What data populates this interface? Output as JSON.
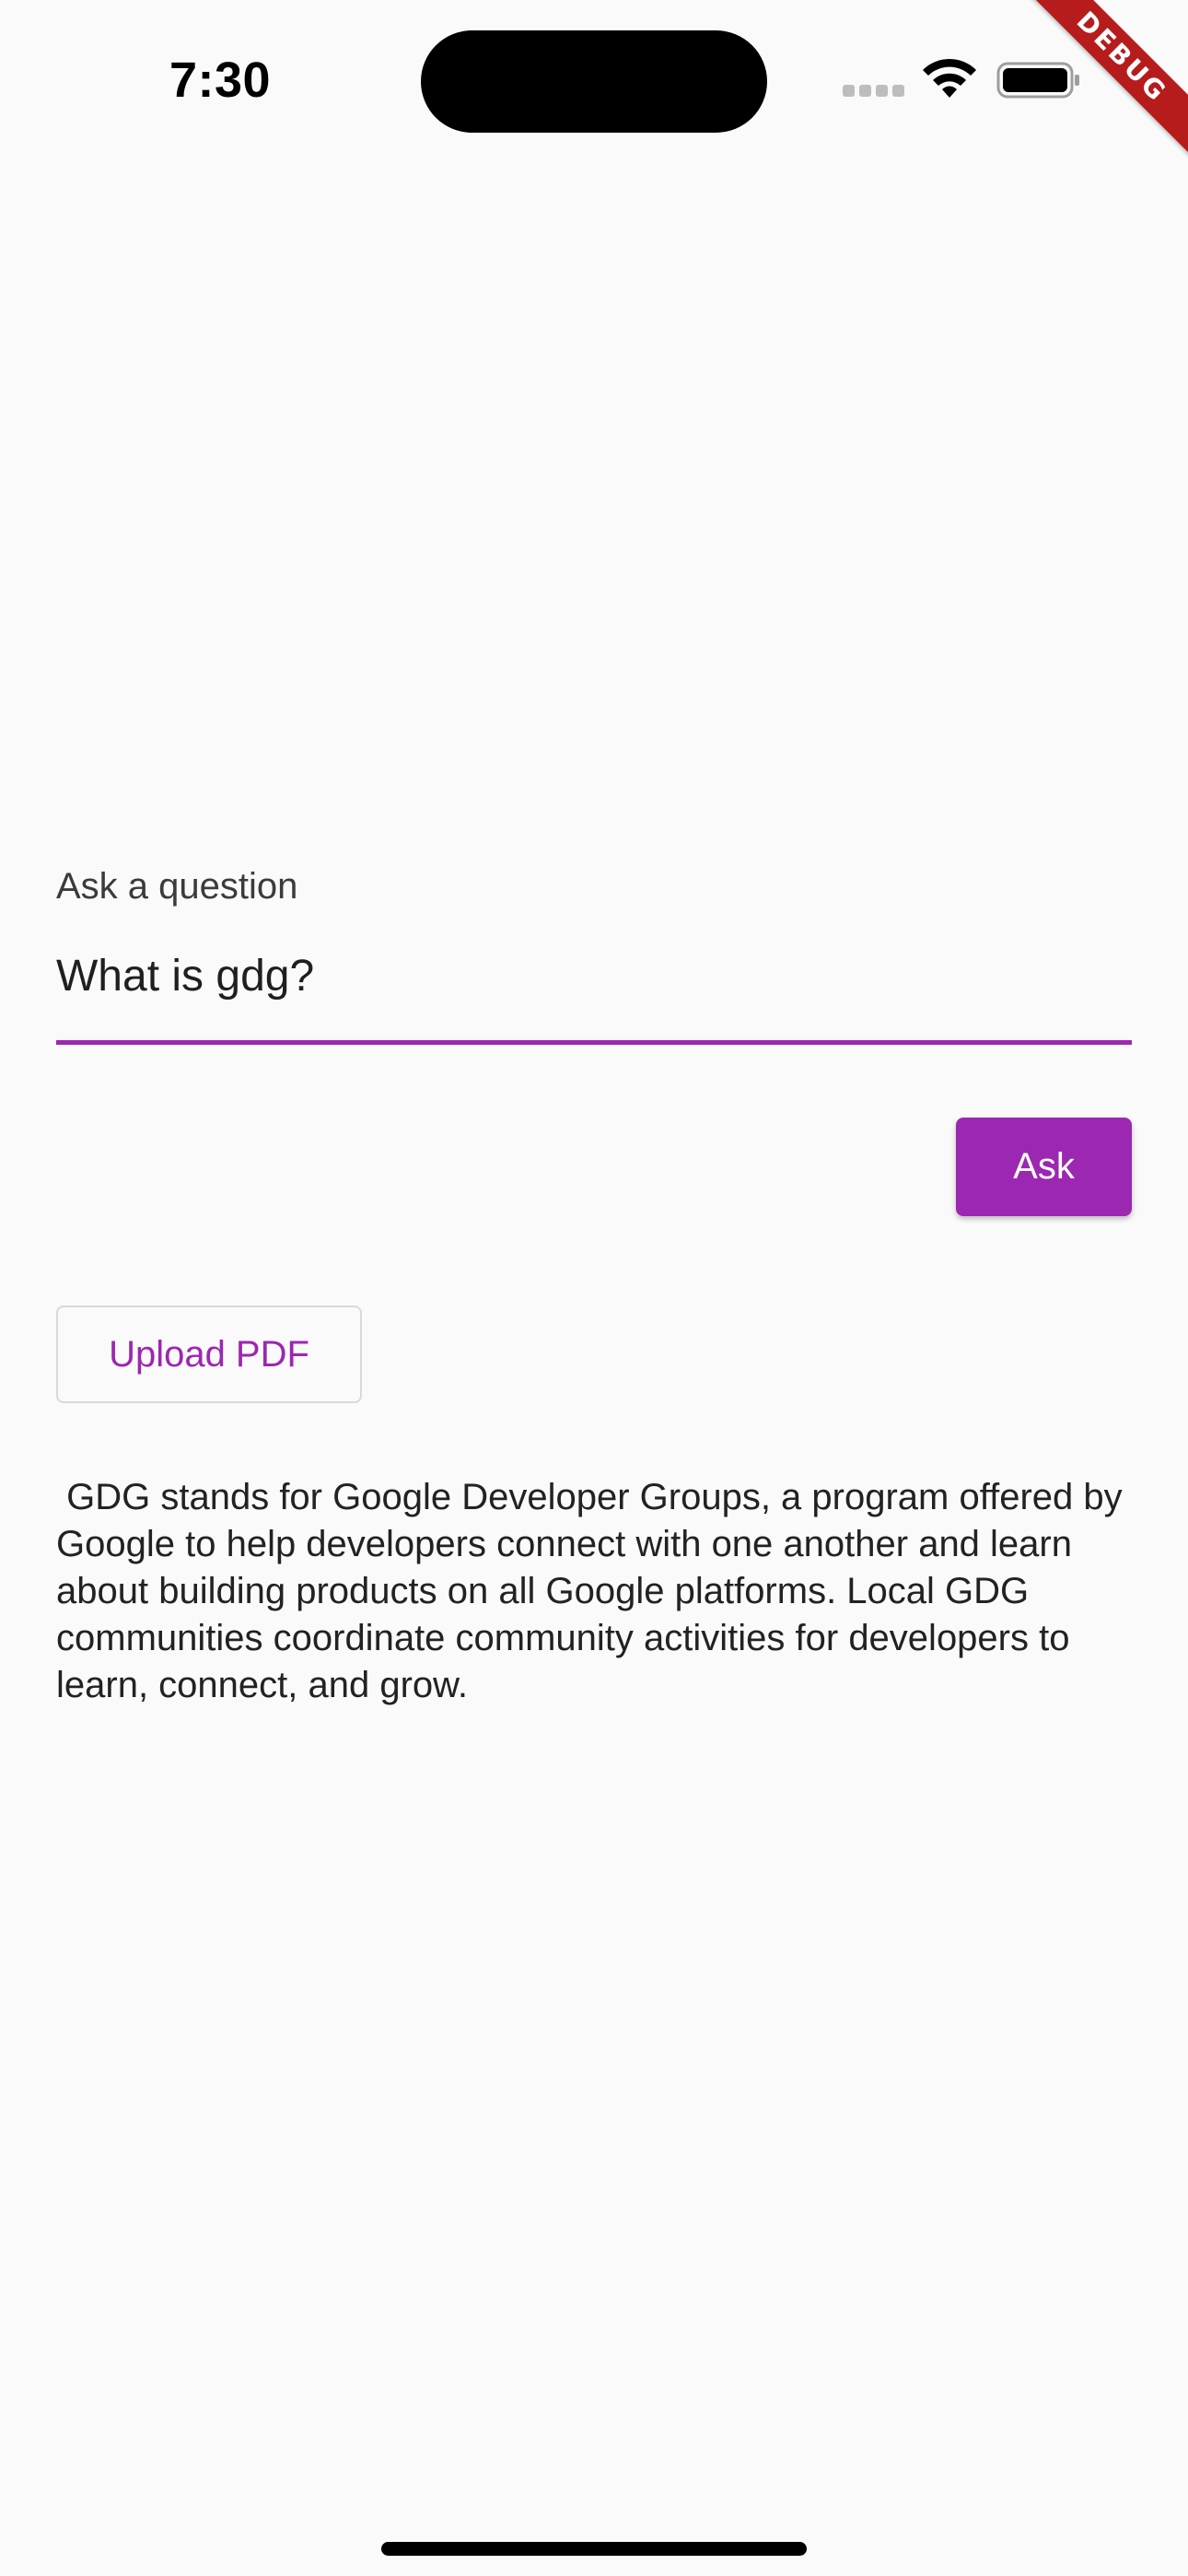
{
  "status_bar": {
    "time": "7:30",
    "icons": [
      "cellular-signal-icon",
      "wifi-icon",
      "battery-icon"
    ]
  },
  "debug_banner": {
    "label": "DEBUG"
  },
  "question_field": {
    "label": "Ask a question",
    "value": "What is gdg?"
  },
  "buttons": {
    "ask_label": "Ask",
    "upload_label": "Upload PDF"
  },
  "answer": {
    "text": " GDG stands for Google Developer Groups, a program offered by Google to help developers connect with one another and learn about building products on all Google platforms. Local GDG communities coordinate community activities for developers to learn, connect, and grow."
  },
  "colors": {
    "accent": "#9c27b0",
    "background": "#fafafa",
    "debug_ribbon": "#b71c1c"
  }
}
